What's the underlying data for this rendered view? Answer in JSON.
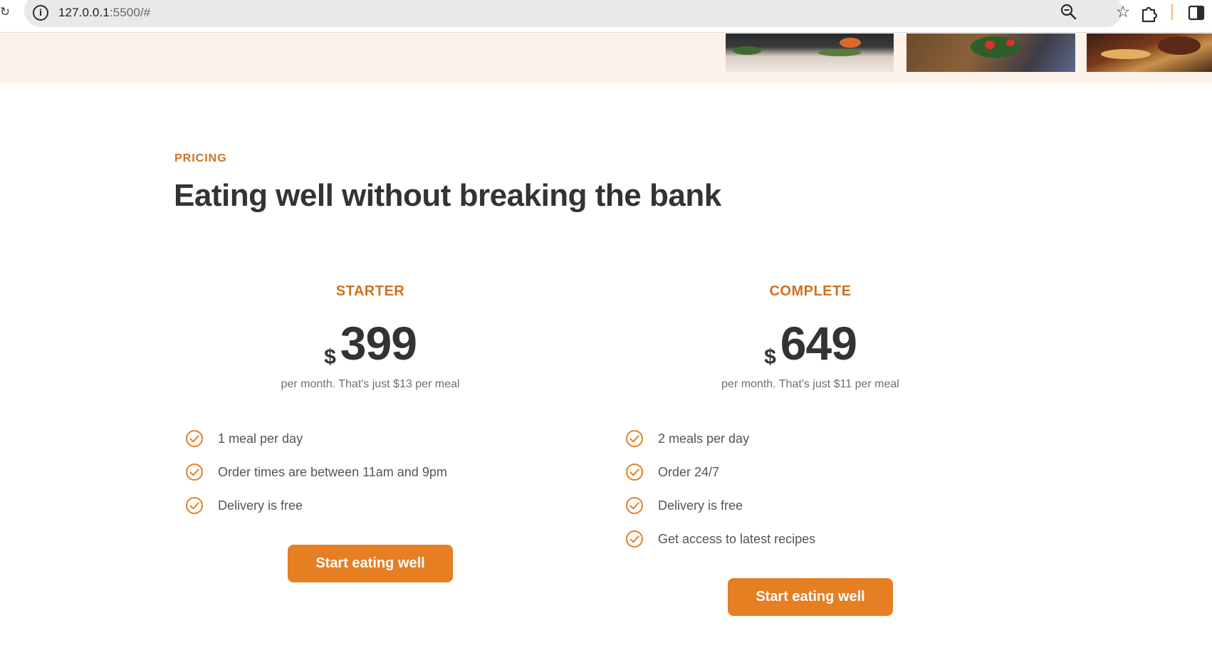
{
  "browser": {
    "url_host": "127.0.0.1",
    "url_path": ":5500/#"
  },
  "pricing": {
    "subheading": "PRICING",
    "title": "Eating well without breaking the bank"
  },
  "plans": [
    {
      "name": "STARTER",
      "currency": "$",
      "price": "399",
      "text": "per month. That's just $13 per meal",
      "features": [
        "1 meal per day",
        "Order times are between 11am and 9pm",
        "Delivery is free"
      ],
      "cta": "Start eating well"
    },
    {
      "name": "COMPLETE",
      "currency": "$",
      "price": "649",
      "text": "per month. That's just $11 per meal",
      "features": [
        "2 meals per day",
        "Order 24/7",
        "Delivery is free",
        "Get access to latest recipes"
      ],
      "cta": "Start eating well"
    }
  ],
  "colors": {
    "accent": "#cf711f",
    "button": "#e67e22",
    "hero_bg": "#fdf2e9",
    "text": "#333333"
  },
  "icons": {
    "reload": "reload-icon",
    "site_info": "info-icon",
    "zoom": "zoom-icon",
    "bookmark": "star-icon",
    "extensions": "puzzle-icon",
    "side_panel": "side-panel-icon",
    "feature_check": "check-circle-icon"
  }
}
